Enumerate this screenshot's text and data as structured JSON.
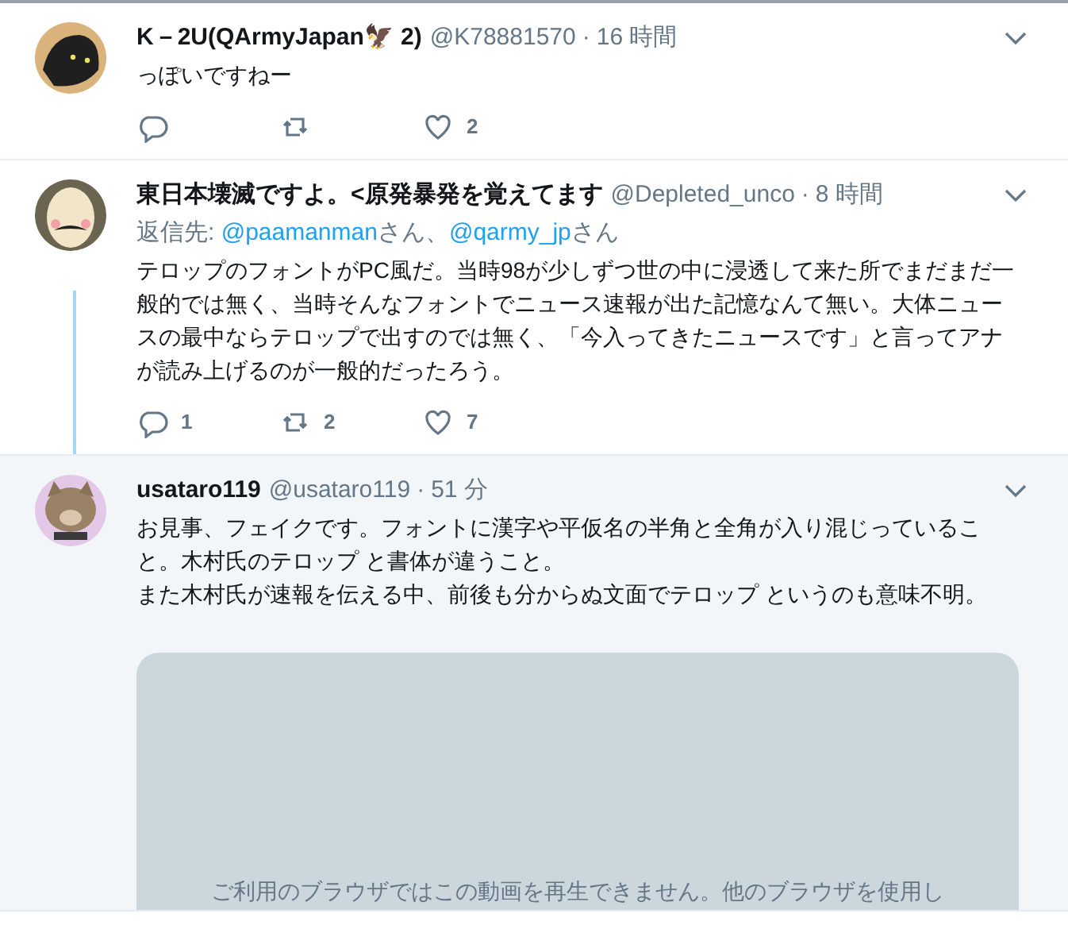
{
  "tweets": [
    {
      "name": "K－2U(QArmyJapan🦅 2)",
      "handle": "@K78881570",
      "separator": "·",
      "time": "16 時間",
      "highlighted": false,
      "thread_line": false,
      "text": [
        "っぽいですねー"
      ],
      "actions": {
        "likes": "2"
      }
    },
    {
      "name": "東日本壊滅ですよ。<原発暴発を覚えてます",
      "handle": "@Depleted_unco",
      "separator": "·",
      "time": "8 時間",
      "highlighted": false,
      "thread_line": true,
      "reply_to": {
        "label": "返信先:",
        "mentions": [
          {
            "handle": "@paamanman",
            "suffix": "さん、"
          },
          {
            "handle": "@qarmy_jp",
            "suffix": "さん"
          }
        ]
      },
      "text": [
        "テロップのフォントがPC風だ。当時98が少しずつ世の中に浸透して来た所でまだまだ一般的では無く、当時そんなフォントでニュース速報が出た記憶なんて無い。大体ニュースの最中ならテロップで出すのでは無く、「今入ってきたニュースです」と言ってアナが読み上げるのが一般的だったろう。"
      ],
      "actions": {
        "replies": "1",
        "retweets": "2",
        "likes": "7"
      }
    },
    {
      "name": "usataro119",
      "handle": "@usataro119",
      "separator": "·",
      "time": "51 分",
      "highlighted": true,
      "thread_line": false,
      "text": [
        "お見事、フェイクです。フォントに漢字や平仮名の半角と全角が入り混じっていること。木村氏のテロップ と書体が違うこと。",
        "また木村氏が速報を伝える中、前後も分からぬ文面でテロップ というのも意味不明。"
      ],
      "video": {
        "message": "ご利用のブラウザではこの動画を再生できません。他のブラウザを使用し"
      }
    }
  ]
}
